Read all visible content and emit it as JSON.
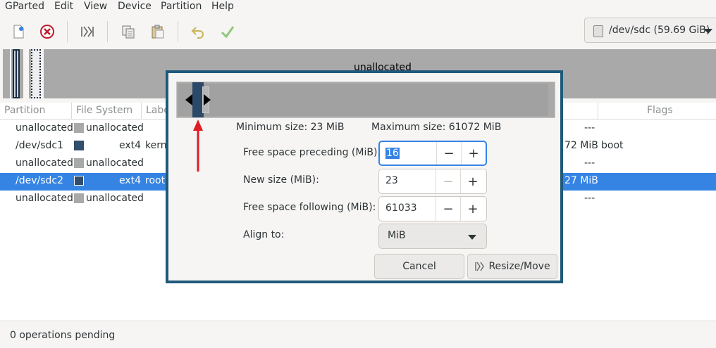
{
  "menu": [
    "GParted",
    "Edit",
    "View",
    "Device",
    "Partition",
    "Help"
  ],
  "toolbar": {
    "icons": [
      "new-icon",
      "delete-icon",
      "resize-move-icon",
      "copy-icon",
      "paste-icon",
      "undo-icon",
      "apply-icon"
    ],
    "device_selector": "/dev/sdc (59.69 GiB)"
  },
  "disk_map": {
    "unallocated_label": "unallocated"
  },
  "table": {
    "headers": {
      "partition": "Partition",
      "filesystem": "File System",
      "label": "Label",
      "flags": "Flags"
    },
    "rows": [
      {
        "partition": "unallocated",
        "fs": "unallocated",
        "fs_name": "",
        "label": "",
        "size_tail": "",
        "flags": "---"
      },
      {
        "partition": "/dev/sdc1",
        "fs": "ext4",
        "fs_name": "ext4",
        "label": "kerne",
        "size_tail": "72 MiB",
        "flags": "boot"
      },
      {
        "partition": "unallocated",
        "fs": "unallocated",
        "fs_name": "",
        "label": "",
        "size_tail": "",
        "flags": "---"
      },
      {
        "partition": "/dev/sdc2",
        "fs": "ext4",
        "fs_name": "ext4",
        "label": "root",
        "size_tail": "27 MiB",
        "flags": "---"
      },
      {
        "partition": "unallocated",
        "fs": "unallocated",
        "fs_name": "",
        "label": "",
        "size_tail": "",
        "flags": "---"
      }
    ]
  },
  "dialog": {
    "min_size": "Minimum size: 23 MiB",
    "max_size": "Maximum size: 61072 MiB",
    "preceding_label": "Free space preceding (MiB):",
    "preceding_value": "16",
    "new_size_label": "New size (MiB):",
    "new_size_value": "23",
    "following_label": "Free space following (MiB):",
    "following_value": "61033",
    "align_label": "Align to:",
    "align_value": "MiB",
    "cancel": "Cancel",
    "resize": "Resize/Move",
    "minus": "−",
    "plus": "+"
  },
  "status": "0 operations pending"
}
